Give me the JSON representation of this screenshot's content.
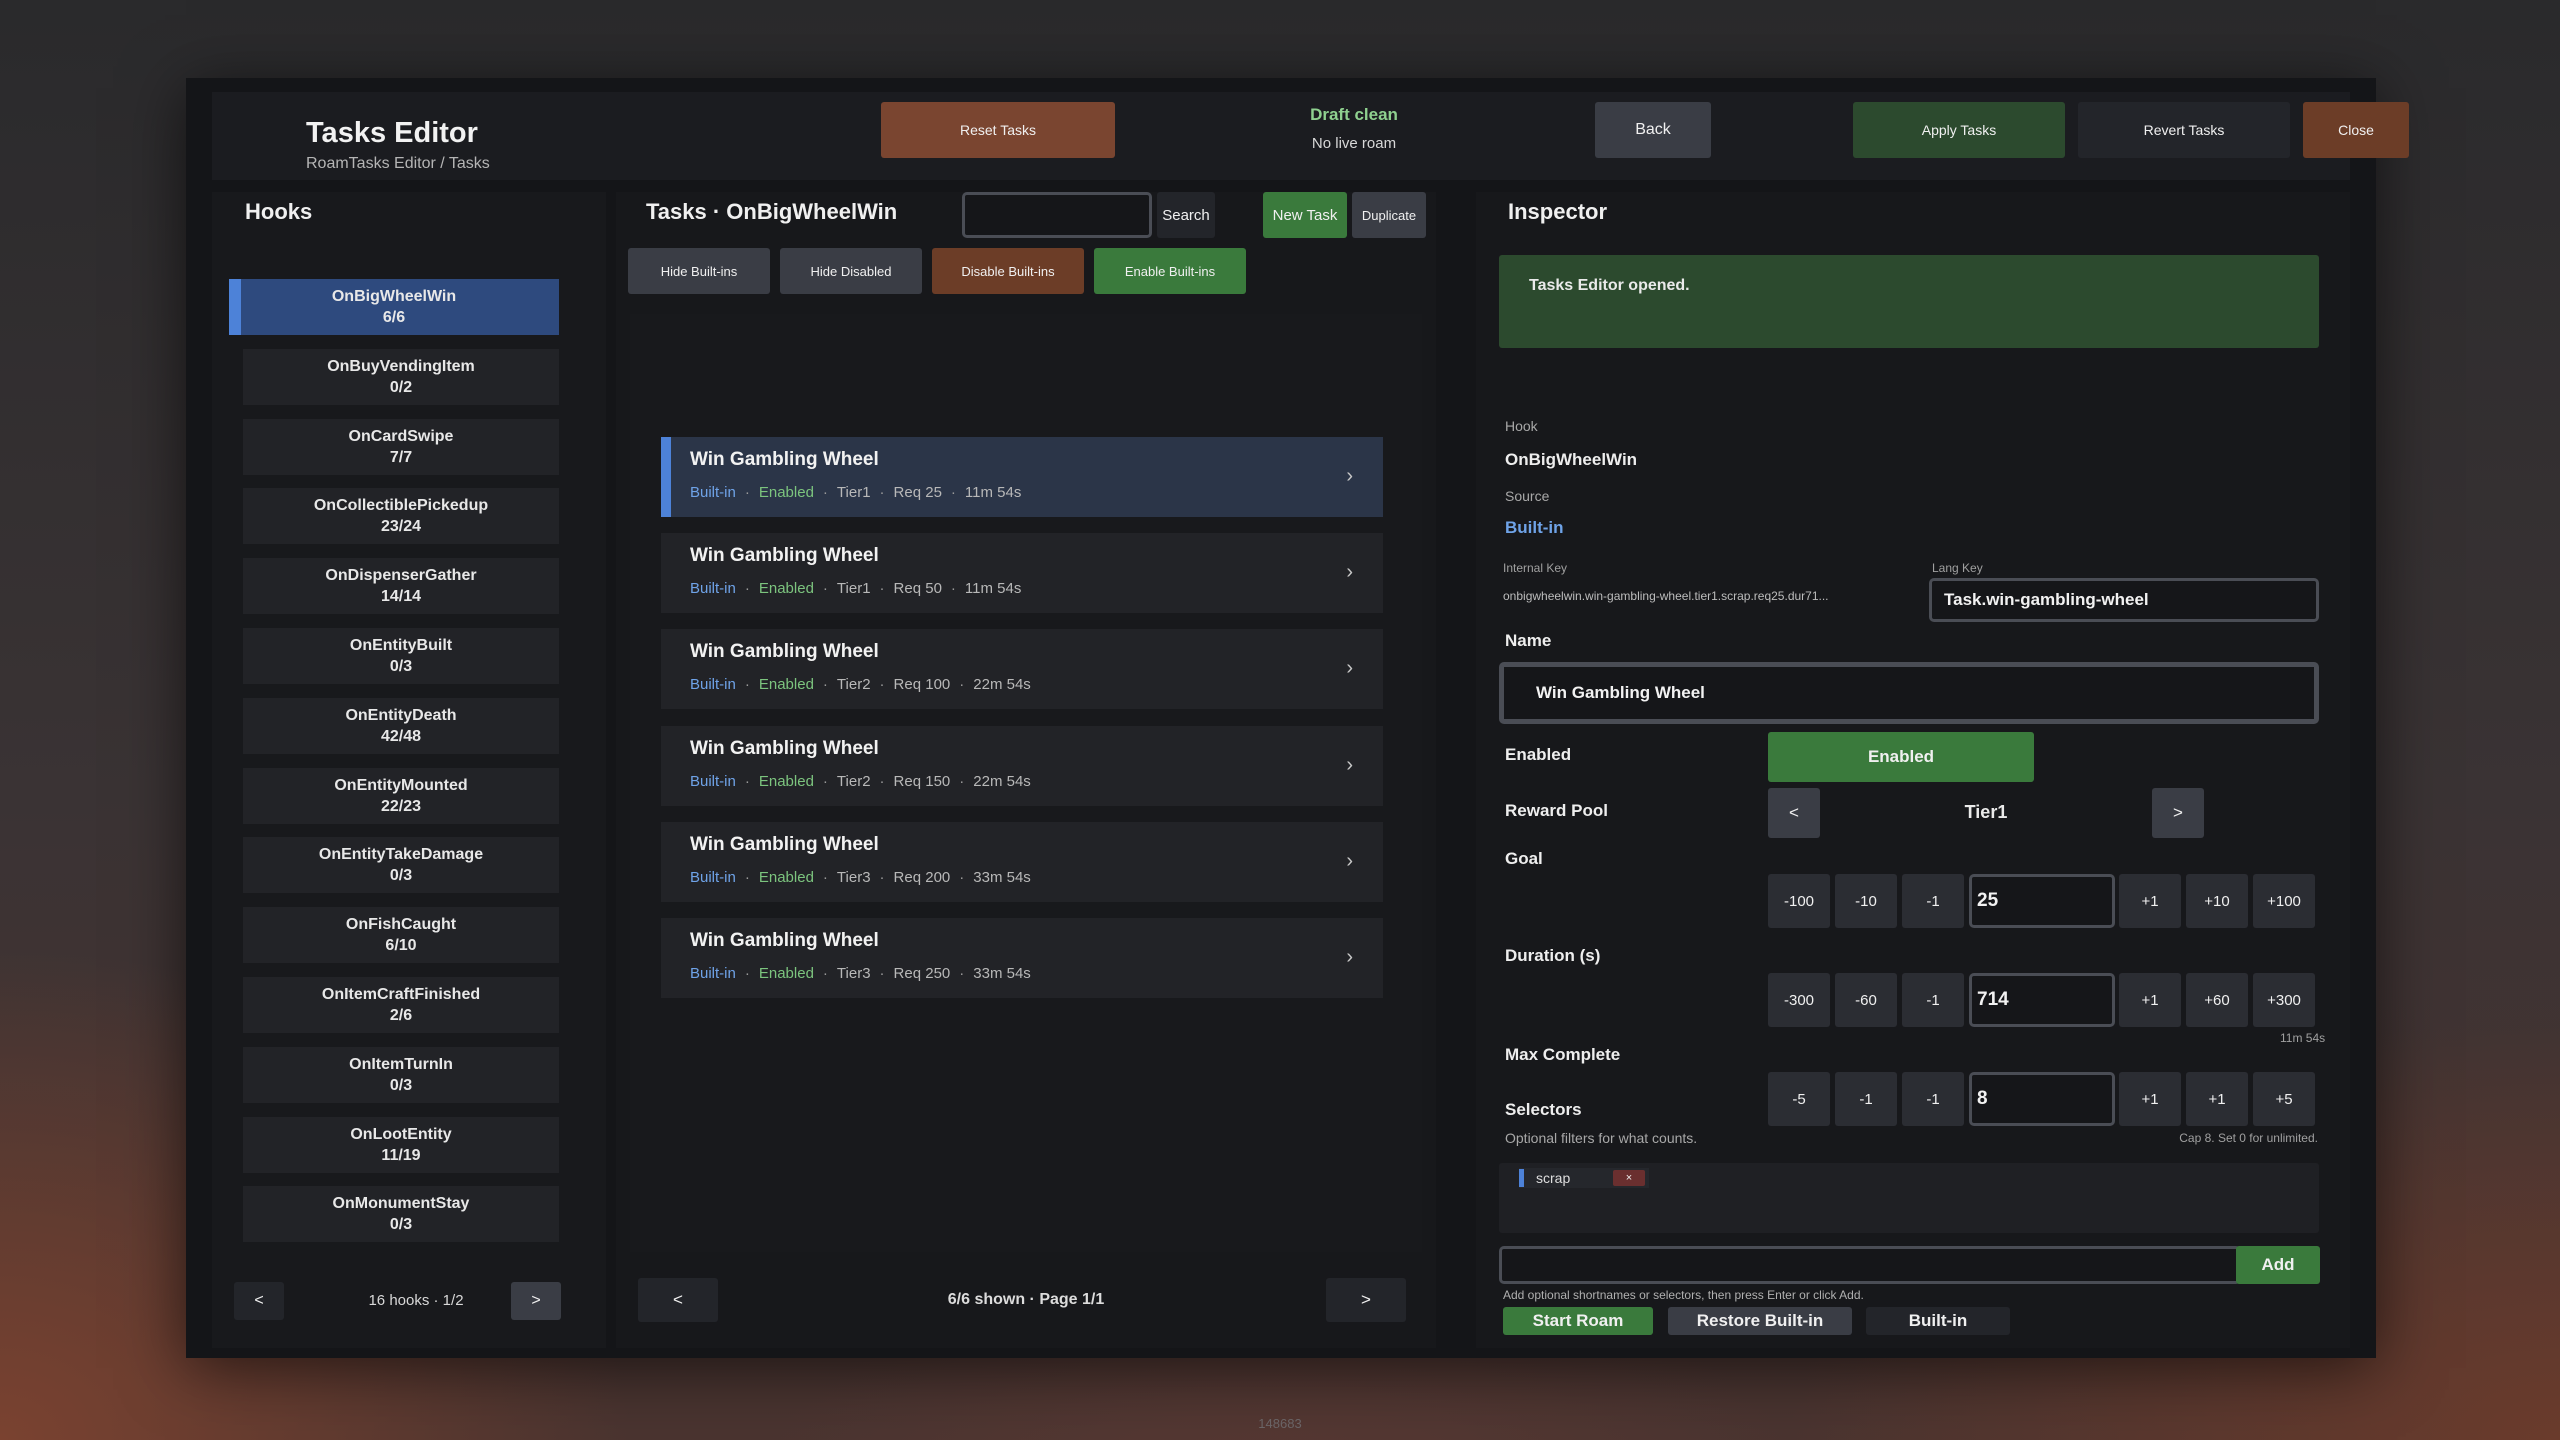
{
  "header": {
    "title": "Tasks Editor",
    "breadcrumb": "RoamTasks Editor / Tasks",
    "reset_label": "Reset Tasks",
    "draft_status": "Draft clean",
    "roam_status": "No live roam",
    "back_label": "Back",
    "apply_label": "Apply Tasks",
    "revert_label": "Revert Tasks",
    "close_label": "Close"
  },
  "hooks": {
    "heading": "Hooks",
    "items": [
      {
        "name": "OnBigWheelWin",
        "count": "6/6"
      },
      {
        "name": "OnBuyVendingItem",
        "count": "0/2"
      },
      {
        "name": "OnCardSwipe",
        "count": "7/7"
      },
      {
        "name": "OnCollectiblePickedup",
        "count": "23/24"
      },
      {
        "name": "OnDispenserGather",
        "count": "14/14"
      },
      {
        "name": "OnEntityBuilt",
        "count": "0/3"
      },
      {
        "name": "OnEntityDeath",
        "count": "42/48"
      },
      {
        "name": "OnEntityMounted",
        "count": "22/23"
      },
      {
        "name": "OnEntityTakeDamage",
        "count": "0/3"
      },
      {
        "name": "OnFishCaught",
        "count": "6/10"
      },
      {
        "name": "OnItemCraftFinished",
        "count": "2/6"
      },
      {
        "name": "OnItemTurnIn",
        "count": "0/3"
      },
      {
        "name": "OnLootEntity",
        "count": "11/19"
      },
      {
        "name": "OnMonumentStay",
        "count": "0/3"
      }
    ],
    "prev": "<",
    "next": ">",
    "pager": "16 hooks · 1/2"
  },
  "tasks": {
    "heading": "Tasks · OnBigWheelWin",
    "search_value": "",
    "search_label": "Search",
    "new_label": "New Task",
    "duplicate_label": "Duplicate",
    "filters": {
      "hide_builtins": "Hide Built-ins",
      "hide_disabled": "Hide Disabled",
      "disable_builtins": "Disable Built-ins",
      "enable_builtins": "Enable Built-ins"
    },
    "sep": "·",
    "items": [
      {
        "name": "Win Gambling Wheel",
        "source": "Built-in",
        "state": "Enabled",
        "tier": "Tier1",
        "req": "Req 25",
        "time": "11m 54s"
      },
      {
        "name": "Win Gambling Wheel",
        "source": "Built-in",
        "state": "Enabled",
        "tier": "Tier1",
        "req": "Req 50",
        "time": "11m 54s"
      },
      {
        "name": "Win Gambling Wheel",
        "source": "Built-in",
        "state": "Enabled",
        "tier": "Tier2",
        "req": "Req 100",
        "time": "22m 54s"
      },
      {
        "name": "Win Gambling Wheel",
        "source": "Built-in",
        "state": "Enabled",
        "tier": "Tier2",
        "req": "Req 150",
        "time": "22m 54s"
      },
      {
        "name": "Win Gambling Wheel",
        "source": "Built-in",
        "state": "Enabled",
        "tier": "Tier3",
        "req": "Req 200",
        "time": "33m 54s"
      },
      {
        "name": "Win Gambling Wheel",
        "source": "Built-in",
        "state": "Enabled",
        "tier": "Tier3",
        "req": "Req 250",
        "time": "33m 54s"
      }
    ],
    "chevron": "›",
    "prev": "<",
    "next": ">",
    "pager": "6/6 shown · Page 1/1"
  },
  "inspector": {
    "heading": "Inspector",
    "notice": "Tasks Editor opened.",
    "hook_label": "Hook",
    "hook_value": "OnBigWheelWin",
    "source_label": "Source",
    "source_value": "Built-in",
    "internal_key_label": "Internal Key",
    "internal_key_value": "onbigwheelwin.win-gambling-wheel.tier1.scrap.req25.dur71...",
    "lang_key_label": "Lang Key",
    "lang_key_value": "Task.win-gambling-wheel",
    "name_label": "Name",
    "name_value": "Win Gambling Wheel",
    "enabled_label": "Enabled",
    "enabled_value": "Enabled",
    "reward_pool_label": "Reward Pool",
    "reward_prev": "<",
    "reward_value": "Tier1",
    "reward_next": ">",
    "goal_label": "Goal",
    "goal_steps": [
      "-100",
      "-10",
      "-1",
      "+1",
      "+10",
      "+100"
    ],
    "goal_value": "25",
    "duration_label": "Duration (s)",
    "duration_steps": [
      "-300",
      "-60",
      "-1",
      "+1",
      "+60",
      "+300"
    ],
    "duration_value": "714",
    "duration_hint": "11m 54s",
    "max_complete_label": "Max Complete",
    "max_steps": [
      "-5",
      "-1",
      "-1",
      "+1",
      "+1",
      "+5"
    ],
    "max_value": "8",
    "max_hint": "Cap 8. Set 0 for unlimited.",
    "selectors_label": "Selectors",
    "selectors_hint": "Optional filters for what counts.",
    "selector_chips": [
      {
        "text": "scrap",
        "remove": "×"
      }
    ],
    "add_input_value": "",
    "add_label": "Add",
    "add_hint": "Add optional shortnames or selectors, then press Enter or click Add.",
    "start_roam_label": "Start Roam",
    "restore_label": "Restore Built-in",
    "builtin_label": "Built-in"
  },
  "footer_id": "148683",
  "colors": {
    "accent_blue": "#4d82d8",
    "green": "#3a7a3c",
    "brown": "#7a4530",
    "builtin_text": "#6fa3e8",
    "enabled_text": "#7cc47e"
  }
}
